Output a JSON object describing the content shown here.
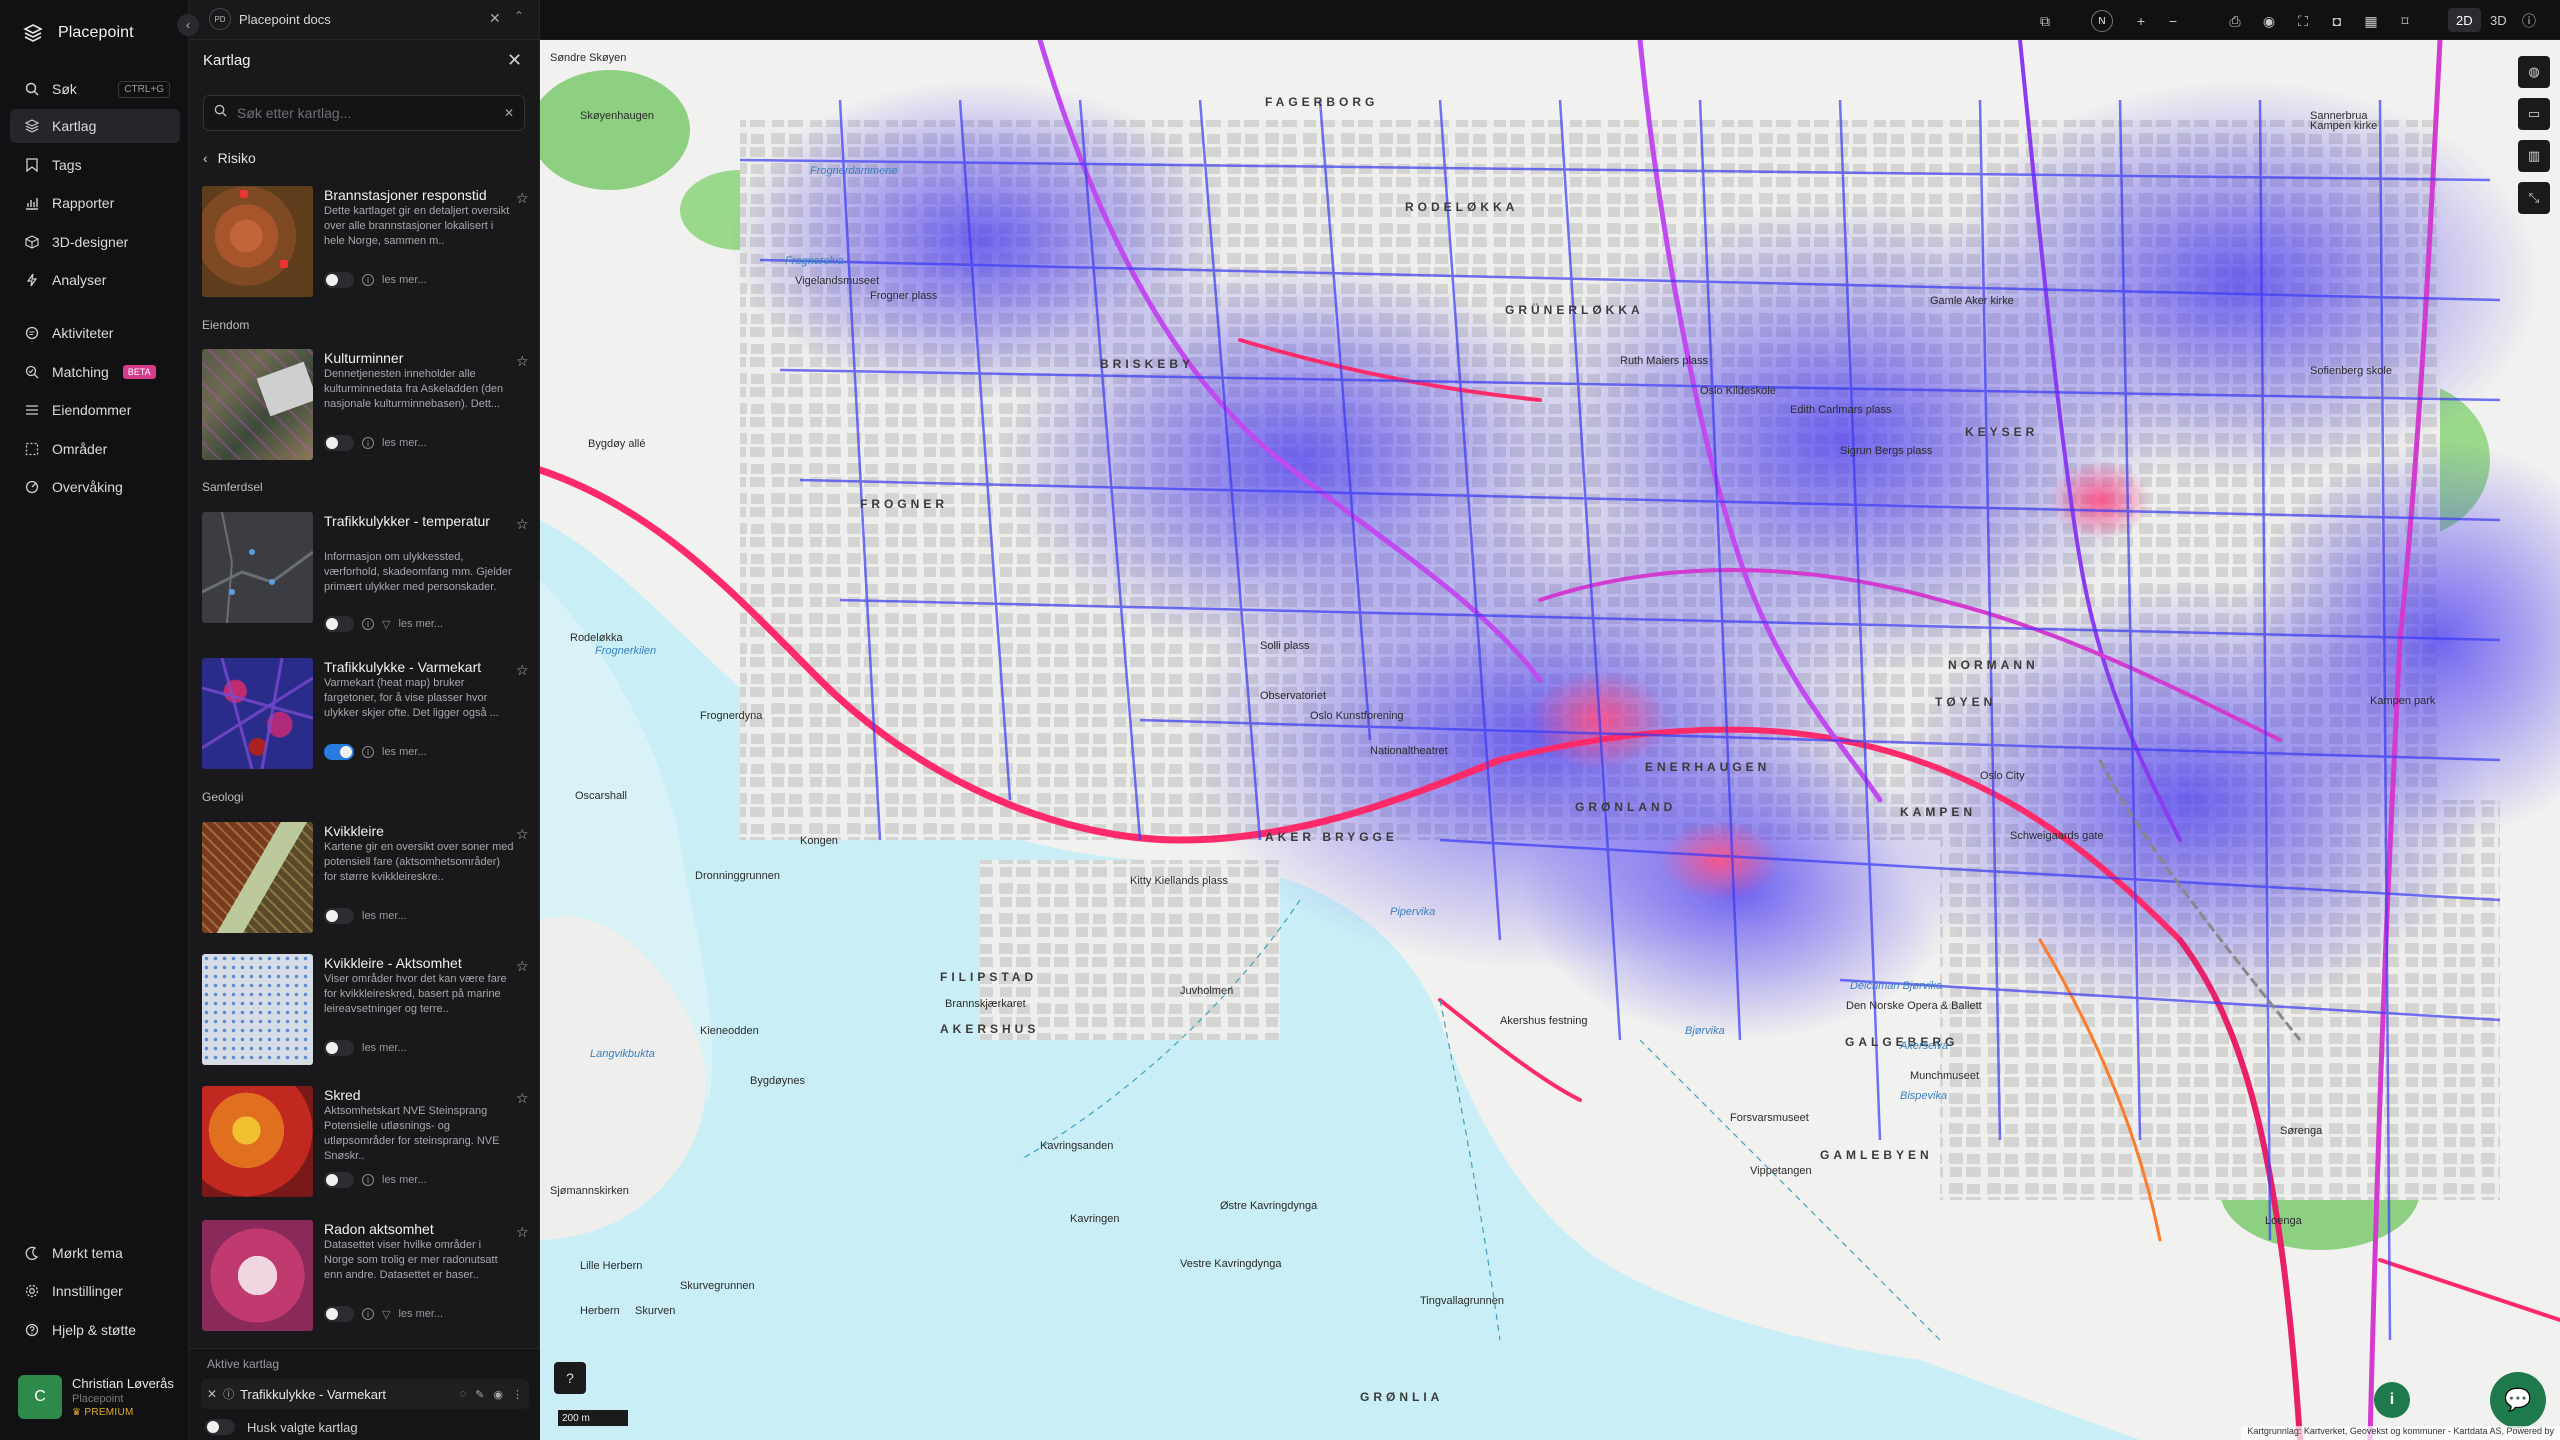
{
  "app": {
    "name": "Placepoint"
  },
  "nav": {
    "items": [
      {
        "label": "Søk",
        "shortcut": "CTRL+G",
        "icon": "search-icon"
      },
      {
        "label": "Kartlag",
        "icon": "layers-icon",
        "active": true
      },
      {
        "label": "Tags",
        "icon": "bookmark-icon"
      },
      {
        "label": "Rapporter",
        "icon": "chart-icon"
      },
      {
        "label": "3D-designer",
        "icon": "cube-icon"
      },
      {
        "label": "Analyser",
        "icon": "bolt-icon"
      },
      {
        "label": "Aktiviteter",
        "icon": "chat-icon"
      },
      {
        "label": "Matching",
        "badge": "BETA",
        "icon": "match-icon"
      },
      {
        "label": "Eiendommer",
        "icon": "list-icon"
      },
      {
        "label": "Områder",
        "icon": "area-icon"
      },
      {
        "label": "Overvåking",
        "icon": "radar-icon"
      }
    ],
    "bottom": [
      {
        "label": "Mørkt tema",
        "icon": "moon-icon"
      },
      {
        "label": "Innstillinger",
        "icon": "gear-icon"
      },
      {
        "label": "Hjelp & støtte",
        "icon": "help-icon"
      }
    ],
    "user": {
      "initial": "C",
      "name": "Christian Løverås",
      "org": "Placepoint",
      "plan": "PREMIUM"
    }
  },
  "tab": {
    "badge": "PD",
    "title": "Placepoint docs"
  },
  "panel": {
    "title": "Kartlag",
    "search_placeholder": "Søk etter kartlag...",
    "back_label": "Risiko",
    "read_more": "les mer...",
    "sections": {
      "eiendom": "Eiendom",
      "samferdsel": "Samferdsel",
      "geologi": "Geologi"
    },
    "layers": [
      {
        "title": "Brannstasjoner responstid",
        "desc": "Dette kartlaget gir en detaljert oversikt over alle brannstasjoner lokalisert i hele Norge, sammen m..",
        "on": false
      },
      {
        "title": "Kulturminner",
        "desc": "Dennetjenesten inneholder alle kulturminnedata fra Askeladden (den nasjonale kulturminnebasen). Dett...",
        "on": false
      },
      {
        "title": "Trafikkulykker - temperatur",
        "desc": "Informasjon om ulykkessted, værforhold, skadeomfang mm. Gjelder primært ulykker med personskader.",
        "on": false
      },
      {
        "title": "Trafikkulykke - Varmekart",
        "desc": "Varmekart (heat map) bruker fargetoner, for å vise plasser hvor ulykker skjer ofte. Det ligger også ...",
        "on": true
      },
      {
        "title": "Kvikkleire",
        "desc": "Kartene gir en oversikt over soner med potensiell fare (aktsomhetsområder) for større kvikkleireskre..",
        "on": false
      },
      {
        "title": "Kvikkleire - Aktsomhet",
        "desc": "Viser områder hvor det kan være fare for kvikkleireskred, basert på marine leireavsetninger og terre..",
        "on": false
      },
      {
        "title": "Skred",
        "desc": "Aktsomhetskart NVE Steinsprang Potensielle utløsnings- og utløpsområder for steinsprang. NVE Snøskr..",
        "on": false
      },
      {
        "title": "Radon aktsomhet",
        "desc": "Datasettet viser hvilke områder i Norge som trolig er mer radonutsatt enn andre. Datasettet er baser..",
        "on": false
      }
    ],
    "active": {
      "label": "Aktive kartlag",
      "item": "Trafikkulykke - Varmekart",
      "remember": "Husk valgte kartlag"
    }
  },
  "topbar": {
    "compass": "N",
    "mode2d": "2D",
    "mode3d": "3D"
  },
  "map": {
    "scale": "200 m",
    "attribution": "Kartgrunnlag: Kartverket, Geovekst og kommuner - Kartdata AS, Powered by",
    "districts": [
      "FAGERBORG",
      "BRISKEBY",
      "FROGNER",
      "RODELØKKA",
      "GRÜNERLØKKA",
      "KEYSER",
      "NORMANN",
      "TØYEN",
      "ENERHAUGEN",
      "GRØNLAND",
      "KAMPEN",
      "AKER BRYGGE",
      "FILIPSTAD",
      "AKERSHUS",
      "GALGEBERG",
      "GAMLEBYEN",
      "GRØNLIA"
    ],
    "places": [
      "Søndre Skøyen",
      "Skøyenhaugen",
      "Frognerdammene",
      "Frognerelva",
      "Vigelandsmuseet",
      "Frogner plass",
      "Bygdøy allé",
      "Rodeløkka",
      "Frognerkilen",
      "Frognerdyna",
      "Oscarshall",
      "Kongen",
      "Dronninggrunnen",
      "Kieneodden",
      "Bygdøynes",
      "Langvikbukta",
      "Sjømannskirken",
      "Lille Herbern",
      "Herbern",
      "Skurven",
      "Skurvegrunnen",
      "Kavringsanden",
      "Kavringen",
      "Østre Kavringdynga",
      "Vestre Kavringdynga",
      "Tingvallagrunnen",
      "Kitty Kiellands plass",
      "Brannskjærkaret",
      "Pipervika",
      "Juvholmen",
      "Nationaltheatret",
      "Solli plass",
      "Observatoriet",
      "Oslo Kunstforening",
      "Akershus festning",
      "Deichman Bjørvika",
      "Den Norske Opera & Ballett",
      "Bjørvika",
      "Akerselva",
      "Bispevika",
      "Munchmuseet",
      "Vippetangen",
      "Forsvarsmuseet",
      "Oslo City",
      "Schweigaards gate",
      "Kampen park",
      "Sofienberg skole",
      "Gamle Aker kirke",
      "Ruth Maiers plass",
      "Edith Carlmars plass",
      "Sigrun Bergs plass",
      "Oslo Kildeskole",
      "Sannerbrua",
      "Kampen kirke",
      "Sørenga",
      "Loenga"
    ]
  }
}
